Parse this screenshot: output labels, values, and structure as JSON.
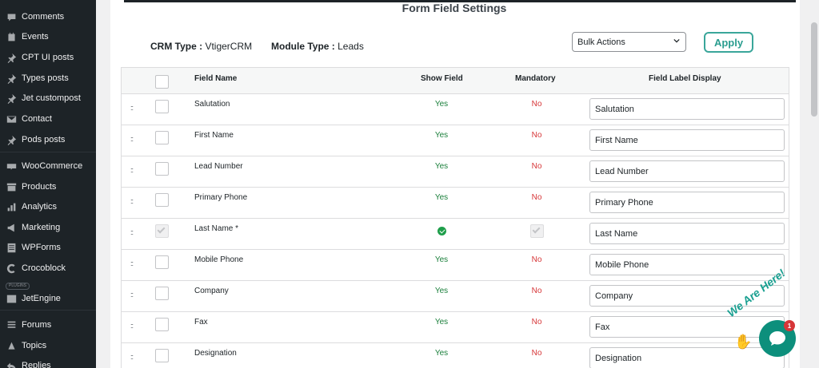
{
  "sidebar": {
    "items": [
      {
        "label": "Comments",
        "icon": "comment-icon"
      },
      {
        "label": "Events",
        "icon": "events-icon"
      },
      {
        "label": "CPT UI posts",
        "icon": "pin-icon"
      },
      {
        "label": "Types posts",
        "icon": "pin-icon"
      },
      {
        "label": "Jet custompost",
        "icon": "pin-icon"
      },
      {
        "label": "Contact",
        "icon": "mail-icon"
      },
      {
        "label": "Pods posts",
        "icon": "pin-icon"
      },
      {
        "label": "WooCommerce",
        "icon": "woo-icon"
      },
      {
        "label": "Products",
        "icon": "archive-icon"
      },
      {
        "label": "Analytics",
        "icon": "chart-icon"
      },
      {
        "label": "Marketing",
        "icon": "megaphone-icon"
      },
      {
        "label": "WPForms",
        "icon": "forms-icon"
      },
      {
        "label": "Crocoblock",
        "icon": "crocoblock-icon"
      },
      {
        "label": "JetEngine",
        "icon": "jetengine-icon"
      },
      {
        "label": "Forums",
        "icon": "forums-icon"
      },
      {
        "label": "Topics",
        "icon": "topics-icon"
      },
      {
        "label": "Replies",
        "icon": "replies-icon"
      }
    ],
    "plugins_tag": "PLUGINS"
  },
  "page": {
    "title": "Form Field Settings",
    "crm_type_label": "CRM Type :",
    "crm_type_value": "VtigerCRM",
    "module_type_label": "Module Type :",
    "module_type_value": "Leads",
    "bulk_actions": "Bulk Actions",
    "apply": "Apply"
  },
  "table": {
    "headers": {
      "field_name": "Field Name",
      "show_field": "Show Field",
      "mandatory": "Mandatory",
      "label_display": "Field Label Display"
    },
    "rows": [
      {
        "name": "Salutation",
        "show": "Yes",
        "mandatory": "No",
        "label": "Salutation",
        "locked": false
      },
      {
        "name": "First Name",
        "show": "Yes",
        "mandatory": "No",
        "label": "First Name",
        "locked": false
      },
      {
        "name": "Lead Number",
        "show": "Yes",
        "mandatory": "No",
        "label": "Lead Number",
        "locked": false
      },
      {
        "name": "Primary Phone",
        "show": "Yes",
        "mandatory": "No",
        "label": "Primary Phone",
        "locked": false
      },
      {
        "name": "Last Name *",
        "show": "",
        "mandatory": "",
        "label": "Last Name",
        "locked": true
      },
      {
        "name": "Mobile Phone",
        "show": "Yes",
        "mandatory": "No",
        "label": "Mobile Phone",
        "locked": false
      },
      {
        "name": "Company",
        "show": "Yes",
        "mandatory": "No",
        "label": "Company",
        "locked": false
      },
      {
        "name": "Fax",
        "show": "Yes",
        "mandatory": "No",
        "label": "Fax",
        "locked": false
      },
      {
        "name": "Designation",
        "show": "Yes",
        "mandatory": "No",
        "label": "Designation",
        "locked": false
      }
    ]
  },
  "chat": {
    "text": "We Are Here!",
    "badge": "1"
  },
  "colors": {
    "sidebar_bg": "#1d2327",
    "accent": "#2a9d8f",
    "yes": "#1a7f3b",
    "no": "#d63638"
  }
}
